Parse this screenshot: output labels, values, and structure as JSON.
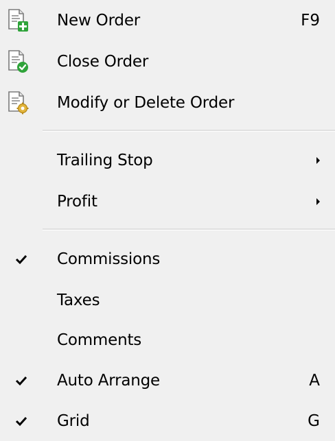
{
  "menu": {
    "items": [
      {
        "label": "New Order",
        "shortcut": "F9",
        "icon": "new-order-icon"
      },
      {
        "label": "Close Order",
        "icon": "close-order-icon"
      },
      {
        "label": "Modify or Delete Order",
        "icon": "modify-order-icon"
      },
      {
        "label": "Trailing Stop",
        "submenu": true
      },
      {
        "label": "Profit",
        "submenu": true
      },
      {
        "label": "Commissions",
        "checked": true
      },
      {
        "label": "Taxes",
        "checked": false
      },
      {
        "label": "Comments",
        "checked": false
      },
      {
        "label": "Auto Arrange",
        "shortcut": "A",
        "checked": true
      },
      {
        "label": "Grid",
        "shortcut": "G",
        "checked": true
      }
    ]
  },
  "colors": {
    "background": "#f0f0f0",
    "separator": "#e0e0e0",
    "icon_green": "#2fa33a",
    "icon_gold": "#e2b53c"
  }
}
